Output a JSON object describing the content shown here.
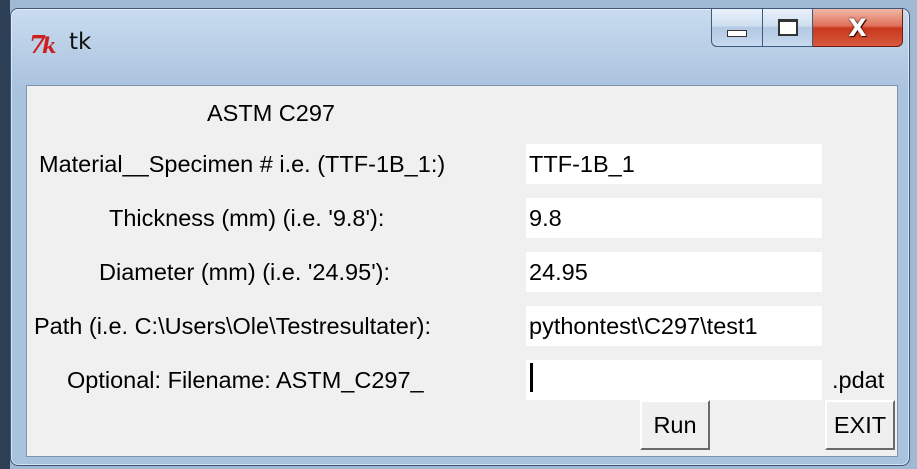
{
  "window": {
    "title": "tk",
    "close_glyph": "X"
  },
  "form": {
    "heading": "ASTM C297",
    "rows": [
      {
        "label": "Material__Specimen # i.e. (TTF-1B_1:)",
        "value": "TTF-1B_1"
      },
      {
        "label": "Thickness (mm) (i.e. '9.8'):",
        "value": "9.8"
      },
      {
        "label": "Diameter (mm) (i.e. '24.95'):",
        "value": "24.95"
      },
      {
        "label": "Path (i.e. C:\\Users\\Ole\\Testresultater):",
        "value": "pythontest\\C297\\test1"
      },
      {
        "label": "Optional: Filename: ASTM_C297_",
        "value": ""
      }
    ],
    "filename_suffix": ".pdat"
  },
  "buttons": {
    "run": "Run",
    "exit": "EXIT"
  },
  "icons": {
    "app": "tk-feather-icon",
    "minimize": "minimize-icon",
    "maximize": "maximize-icon",
    "close": "close-icon"
  },
  "colors": {
    "titlebar": "#b9cfe6",
    "client_bg": "#f0f0f0",
    "close_button": "#c8381c",
    "tk_logo": "#cc1f1f"
  }
}
